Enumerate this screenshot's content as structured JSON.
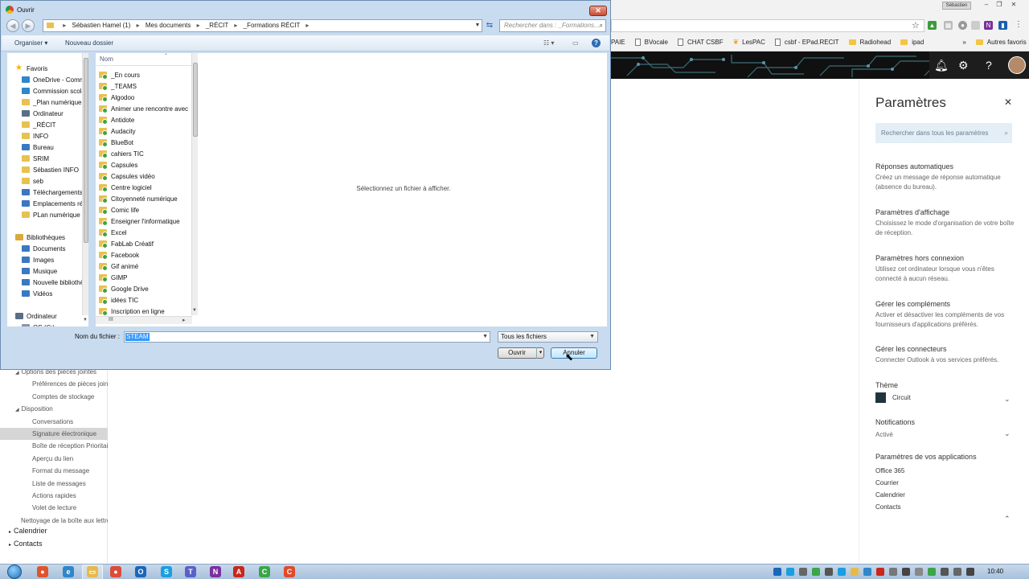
{
  "dialog": {
    "title": "Ouvrir",
    "close_label": "✕",
    "back_glyph": "◀",
    "forward_glyph": "▶",
    "address_path": [
      "Sébastien Hamel (1)",
      "Mes documents",
      "_RÉCIT",
      "_Formations RÉCIT"
    ],
    "search_placeholder": "Rechercher dans : _Formations...",
    "organize_label": "Organiser ▾",
    "new_folder_label": "Nouveau dossier",
    "nav_tree": [
      {
        "label": "Favoris",
        "kind": "star"
      },
      {
        "label": "OneDrive - Commission scolaire",
        "kind": "cloud"
      },
      {
        "label": "Commission scolaire",
        "kind": "cloud"
      },
      {
        "label": "_Plan numérique",
        "kind": "folder"
      },
      {
        "label": "Ordinateur",
        "kind": "pc"
      },
      {
        "label": "_RÉCIT",
        "kind": "folder"
      },
      {
        "label": "INFO",
        "kind": "folder"
      },
      {
        "label": "Bureau",
        "kind": "blue"
      },
      {
        "label": "SRIM",
        "kind": "folder"
      },
      {
        "label": "Sébastien INFO",
        "kind": "folder"
      },
      {
        "label": "seb",
        "kind": "folder"
      },
      {
        "label": "Téléchargements",
        "kind": "blue"
      },
      {
        "label": "Emplacements récents",
        "kind": "blue"
      },
      {
        "label": "PLan numérique",
        "kind": "folder"
      },
      {
        "label": "Bibliothèques",
        "kind": "lib"
      },
      {
        "label": "Documents",
        "kind": "blue"
      },
      {
        "label": "Images",
        "kind": "blue"
      },
      {
        "label": "Musique",
        "kind": "blue"
      },
      {
        "label": "Nouvelle bibliothèque",
        "kind": "blue"
      },
      {
        "label": "Vidéos",
        "kind": "blue"
      },
      {
        "label": "Ordinateur",
        "kind": "pc"
      },
      {
        "label": "OS (C:)",
        "kind": "drive"
      }
    ],
    "list_header": "Nom",
    "files": [
      "_En cours",
      "_TEAMS",
      "Algodoo",
      "Animer une rencontre avec",
      "Antidote",
      "Audacity",
      "BlueBot",
      "cahiers TIC",
      "Capsules",
      "Capsules vidéo",
      "Centre logiciel",
      "Citoyenneté numérique",
      "Comic life",
      "Enseigner l'informatique",
      "Excel",
      "FabLab Créatif",
      "Facebook",
      "Gif animé",
      "GIMP",
      "Google Drive",
      "idées TIC",
      "Inscription en ligne"
    ],
    "preview_message": "Sélectionnez un fichier à afficher.",
    "filename_label": "Nom du fichier :",
    "filename_value": "STEAM",
    "filter_value": "Tous les fichiers",
    "open_label": "Ouvrir",
    "cancel_label": "Annuler",
    "hscroll_glyph": "III"
  },
  "browser": {
    "user_chip": "Sébastien",
    "bookmarks": [
      {
        "label": "PAIE",
        "kind": "none"
      },
      {
        "label": "BVocale",
        "kind": "page"
      },
      {
        "label": "CHAT CSBF",
        "kind": "page"
      },
      {
        "label": "LesPAC",
        "kind": "star"
      },
      {
        "label": "csbf - EPad.RECIT",
        "kind": "page"
      },
      {
        "label": "Radiohead",
        "kind": "folder"
      },
      {
        "label": "ipad",
        "kind": "folder"
      }
    ],
    "more_bookmarks": "»",
    "other_bookmarks": "Autres favoris"
  },
  "outlook": {
    "nav_items": [
      {
        "label": "Options des pièces jointes",
        "indent": 2,
        "arrow": "◢"
      },
      {
        "label": "Préférences de pièces jointes",
        "indent": 3
      },
      {
        "label": "Comptes de stockage",
        "indent": 3
      },
      {
        "label": "Disposition",
        "indent": 2,
        "arrow": "◢"
      },
      {
        "label": "Conversations",
        "indent": 3
      },
      {
        "label": "Signature électronique",
        "indent": 3,
        "selected": true
      },
      {
        "label": "Boîte de réception Prioritaire",
        "indent": 3
      },
      {
        "label": "Aperçu du lien",
        "indent": 3
      },
      {
        "label": "Format du message",
        "indent": 3
      },
      {
        "label": "Liste de messages",
        "indent": 3
      },
      {
        "label": "Actions rapides",
        "indent": 3
      },
      {
        "label": "Volet de lecture",
        "indent": 3
      },
      {
        "label": "Nettoyage de la boîte aux lettres",
        "indent": 2
      },
      {
        "label": "Calendrier",
        "indent": 1,
        "arrow": "▸",
        "top": true
      },
      {
        "label": "Contacts",
        "indent": 1,
        "arrow": "▸",
        "top": true
      }
    ],
    "settings": {
      "title": "Paramètres",
      "search_placeholder": "Rechercher dans tous les paramètres",
      "sections": [
        {
          "title": "Réponses automatiques",
          "desc": "Créez un message de réponse automatique (absence du bureau)."
        },
        {
          "title": "Paramètres d'affichage",
          "desc": "Choisissez le mode d'organisation de votre boîte de réception."
        },
        {
          "title": "Paramètres hors connexion",
          "desc": "Utilisez cet ordinateur lorsque vous n'êtes connecté à aucun réseau."
        },
        {
          "title": "Gérer les compléments",
          "desc": "Activer et désactiver les compléments de vos fournisseurs d'applications préférés."
        },
        {
          "title": "Gérer les connecteurs",
          "desc": "Connecter Outlook à vos services préférés."
        }
      ],
      "theme_title": "Thème",
      "theme_value": "Circuit",
      "notifications_title": "Notifications",
      "notifications_value": "Activé",
      "apps_title": "Paramètres de vos applications",
      "apps": [
        "Office 365",
        "Courrier",
        "Calendrier",
        "Contacts"
      ]
    }
  },
  "taskbar": {
    "clock": "10:40",
    "apps": [
      {
        "name": "firefox",
        "color": "#e0542b",
        "glyph": "●"
      },
      {
        "name": "ie",
        "color": "#2f86c9",
        "glyph": "e"
      },
      {
        "name": "explorer",
        "color": "#e6b94a",
        "glyph": "▭"
      },
      {
        "name": "chrome",
        "color": "#dd4b39",
        "glyph": "●"
      },
      {
        "name": "outlook",
        "color": "#1a66b8",
        "glyph": "O"
      },
      {
        "name": "skype",
        "color": "#1a9ee0",
        "glyph": "S"
      },
      {
        "name": "teams",
        "color": "#5b5fc7",
        "glyph": "T"
      },
      {
        "name": "onenote",
        "color": "#7b2f9e",
        "glyph": "N"
      },
      {
        "name": "acrobat",
        "color": "#c9261c",
        "glyph": "A"
      },
      {
        "name": "camtasia",
        "color": "#3aa648",
        "glyph": "C"
      },
      {
        "name": "recorder",
        "color": "#e04b2b",
        "glyph": "C"
      }
    ]
  },
  "colors": {
    "dialog_bg": "#c9dbee",
    "accent": "#3399ff",
    "settings_search_bg": "#e3eef7"
  }
}
